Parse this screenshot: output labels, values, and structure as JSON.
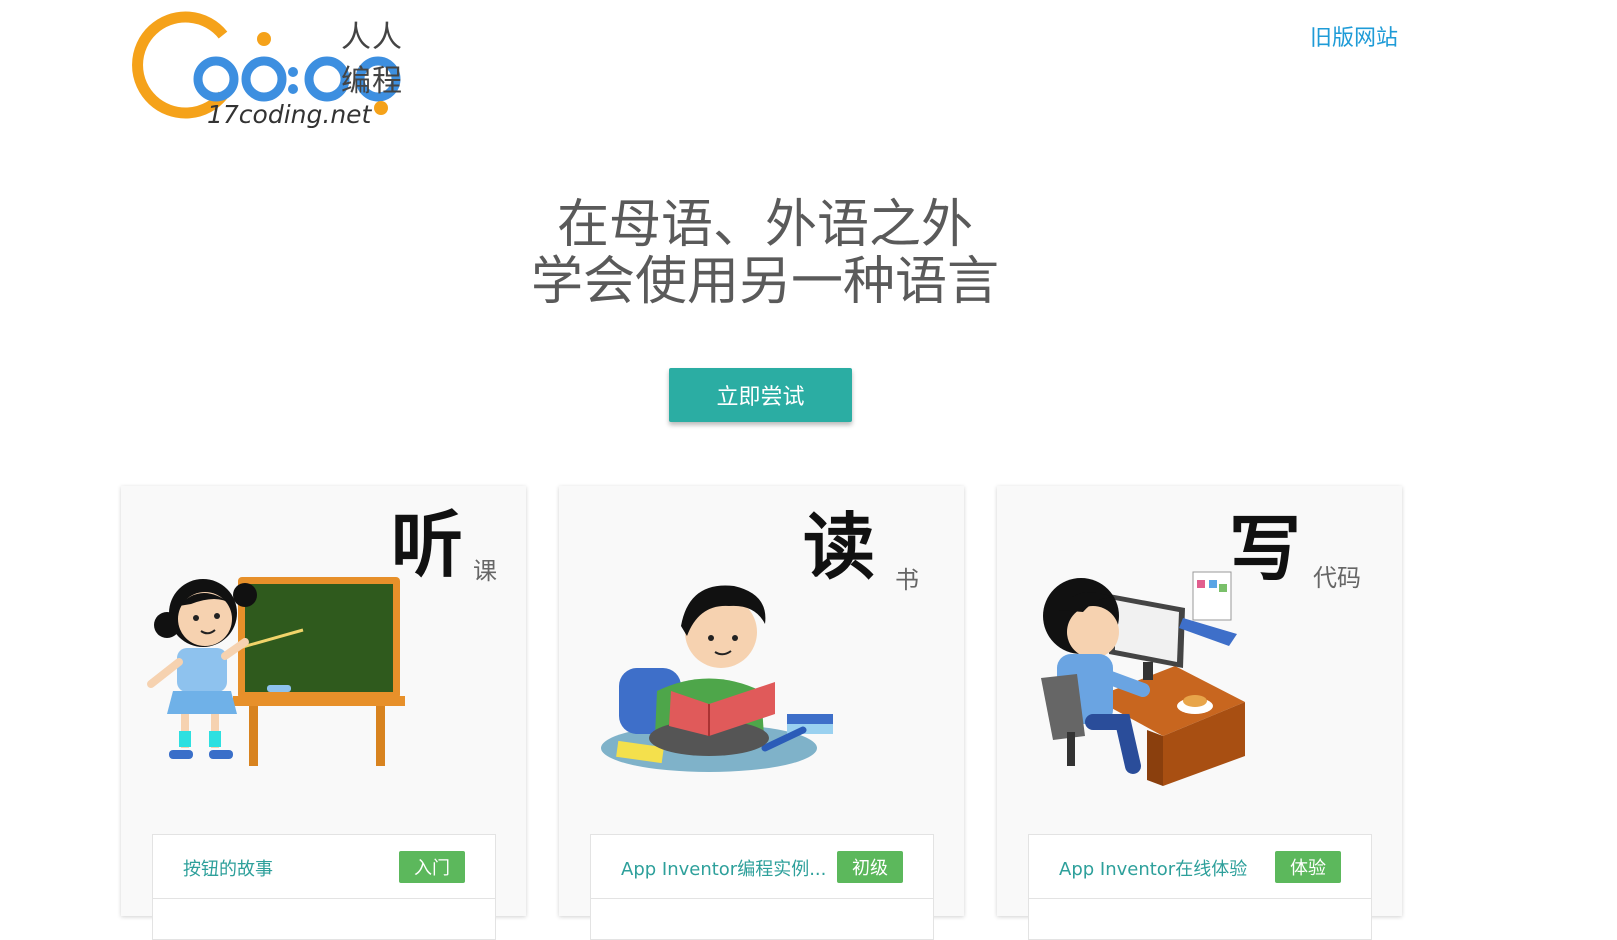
{
  "header": {
    "logo": {
      "brand": "人人编程",
      "domain": "17coding.net"
    },
    "old_site_link": "旧版网站"
  },
  "hero": {
    "line1": "在母语、外语之外",
    "line2": "学会使用另一种语言",
    "cta_label": "立即尝试"
  },
  "cards": [
    {
      "big_char": "听",
      "sub_char": "课",
      "item_title": "按钮的故事",
      "badge": "入门",
      "illustration": "teacher-girl-blackboard"
    },
    {
      "big_char": "读",
      "sub_char": "书",
      "item_title": "App Inventor编程实例...",
      "badge": "初级",
      "illustration": "boy-reading-book"
    },
    {
      "big_char": "写",
      "sub_char": "代码",
      "item_title": "App Inventor在线体验",
      "badge": "体验",
      "illustration": "boy-at-computer"
    }
  ],
  "colors": {
    "accent": "#2bada3",
    "link": "#1e9bd7",
    "badge": "#5cb85c",
    "logo_orange": "#f5a21a",
    "logo_blue": "#3d8fe0",
    "item_text": "#2ea09b"
  }
}
